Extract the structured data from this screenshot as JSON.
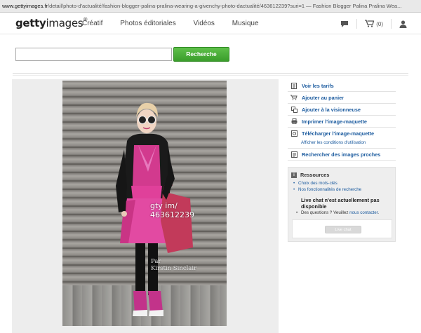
{
  "browser": {
    "url_host": "www.gettyimages.fr",
    "url_path": "/detail/photo-d'actualité/fashion-blogger-palina-pralina-wearing-a-givenchy-photo-dactualité/463612239?suri=1 — Fashion Blogger Palina Pralina Wea..."
  },
  "header": {
    "logo_a": "getty",
    "logo_b": "images",
    "logo_sup": "®",
    "nav": [
      "Créatif",
      "Photos éditoriales",
      "Vidéos",
      "Musique"
    ],
    "cart_count": "(0)"
  },
  "search": {
    "value": "",
    "placeholder": "",
    "button_label": "Recherche"
  },
  "image": {
    "watermark_line1": "gty im/",
    "watermark_line2": "463612239",
    "credit_line1": "Par",
    "credit_line2": "Kirstin Sinclair"
  },
  "actions": [
    {
      "label": "Voir les tarifs",
      "icon": "price-list-icon"
    },
    {
      "label": "Ajouter au panier",
      "icon": "cart-icon"
    },
    {
      "label": "Ajouter à la visionneuse",
      "icon": "lightbox-icon"
    },
    {
      "label": "Imprimer l'image-maquette",
      "icon": "print-icon"
    },
    {
      "label": "Télécharger l'image-maquette",
      "icon": "download-icon",
      "sublabel": "Afficher les conditions d'utilisation"
    },
    {
      "label": "Rechercher des images proches",
      "icon": "similar-images-icon"
    }
  ],
  "resources": {
    "title": "Ressources",
    "links": [
      "Choix des mots-clés",
      "Nos fonctionnalités de recherche"
    ],
    "chat_title": "Live chat n'est actuellement pas disponible",
    "chat_question": "Des questions ? Veuillez",
    "chat_contact": "nous contacter",
    "chat_button": "Live chat"
  },
  "colors": {
    "accent_link": "#1a5a9e",
    "search_button": "#3a9d2b"
  }
}
